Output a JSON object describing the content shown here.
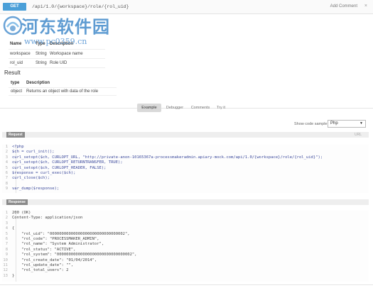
{
  "topbar": {
    "method": "GET",
    "path": "/api/1.0/{workspace}/role/{rol_uid}",
    "add_comment": "Add Comment",
    "close": "×"
  },
  "watermark": {
    "title": "河东软件园",
    "url": "www.pc0359.cn"
  },
  "params": {
    "headers": [
      "Name",
      "Type",
      "Description"
    ],
    "rows": [
      [
        "workspace",
        "String",
        "Workspace name"
      ],
      [
        "rol_uid",
        "String",
        "Role UID"
      ]
    ]
  },
  "result": {
    "heading": "Result",
    "headers": [
      "type",
      "Description"
    ],
    "rows": [
      [
        "object",
        "Returns an object with data of the role"
      ]
    ]
  },
  "tabs": [
    "Example",
    "Debugger",
    "Comments",
    "Try it"
  ],
  "code_sample": {
    "label": "Show code sample",
    "selected": "Php"
  },
  "request": {
    "tag": "Request",
    "right": "URL",
    "lines": [
      {
        "n": "1",
        "t": "<?php"
      },
      {
        "n": "2",
        "t": "$ch = curl_init();"
      },
      {
        "n": "3",
        "t": "curl_setopt($ch, CURLOPT_URL, \"http://private-anon-10165367a-processmakeradmin.apiary-mock.com/api/1.0/{workspace}/role/{rol_uid}\");"
      },
      {
        "n": "4",
        "t": "curl_setopt($ch, CURLOPT_RETURNTRANSFER, TRUE);"
      },
      {
        "n": "5",
        "t": "curl_setopt($ch, CURLOPT_HEADER, FALSE);"
      },
      {
        "n": "6",
        "t": "$response = curl_exec($ch);"
      },
      {
        "n": "7",
        "t": "curl_close($ch);"
      },
      {
        "n": "8",
        "t": ""
      },
      {
        "n": "9",
        "t": "var_dump($response);"
      }
    ]
  },
  "response": {
    "tag": "Response",
    "lines": [
      {
        "n": "1",
        "t": "200 (OK)"
      },
      {
        "n": "2",
        "t": "Content-Type: application/json"
      },
      {
        "n": "3",
        "t": ""
      },
      {
        "n": "4",
        "t": "{"
      },
      {
        "n": "5",
        "t": "    \"rol_uid\": \"00000000000000000000000000000002\","
      },
      {
        "n": "6",
        "t": "    \"rol_code\": \"PROCESSMAKER_ADMIN\","
      },
      {
        "n": "7",
        "t": "    \"rol_name\": \"System Administrator\","
      },
      {
        "n": "8",
        "t": "    \"rol_status\": \"ACTIVE\","
      },
      {
        "n": "9",
        "t": "    \"rol_system\": \"00000000000000000000000000000002\","
      },
      {
        "n": "10",
        "t": "    \"rol_create_date\": \"01/04/2014\","
      },
      {
        "n": "11",
        "t": "    \"rol_update_date\": \"\","
      },
      {
        "n": "12",
        "t": "    \"rol_total_users\": 2"
      },
      {
        "n": "13",
        "t": "}"
      }
    ]
  },
  "colors": {
    "method_badge": "#4a9fd8",
    "code_text": "#3c4a9c",
    "watermark": "#2a7bc4"
  }
}
